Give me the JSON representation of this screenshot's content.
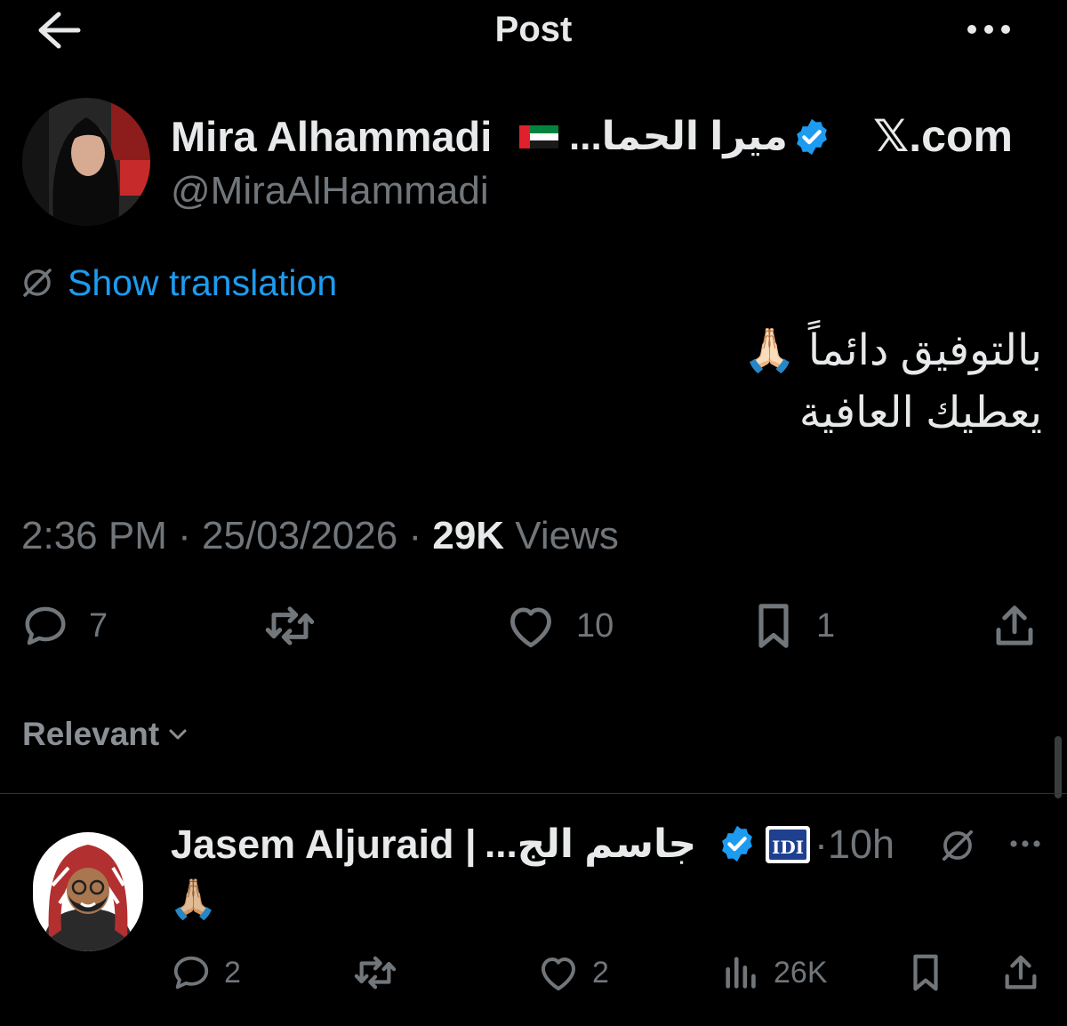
{
  "header": {
    "title": "Post",
    "back_icon": "arrow-left-icon",
    "more_icon": "ellipsis-icon"
  },
  "post": {
    "author": {
      "name": "Mira Alhammadi",
      "flag": "🇦🇪",
      "name_ar": "ميرا الحما...",
      "handle": "@MiraAlHammadi",
      "verified": true
    },
    "watermark": "𝕏.com",
    "show_translation": "Show translation",
    "body_lines": [
      "بالتوفيق دائماً 🙏🏻",
      "يعطيك العافية"
    ],
    "meta": {
      "time": "2:36 PM",
      "date": "25/03/2026",
      "views_count": "29K",
      "views_label": "Views",
      "sep": "·"
    },
    "actions": {
      "replies": "7",
      "reposts": "",
      "likes": "10",
      "bookmarks": "1"
    }
  },
  "replies_section": {
    "sort_label": "Relevant"
  },
  "reply": {
    "author": {
      "name": "Jasem Aljuraid |",
      "name_ar": "جاسم الج...",
      "verified": true,
      "affiliation_badge": "IDI"
    },
    "time": "10h",
    "sep": "·",
    "body": "🙏🏼",
    "actions": {
      "replies": "2",
      "reposts": "",
      "likes": "2",
      "views": "26K"
    }
  },
  "colors": {
    "background": "#000000",
    "text": "#e7e9ea",
    "muted": "#71767b",
    "accent": "#1d9bf0",
    "verified": "#1d9bf0"
  }
}
